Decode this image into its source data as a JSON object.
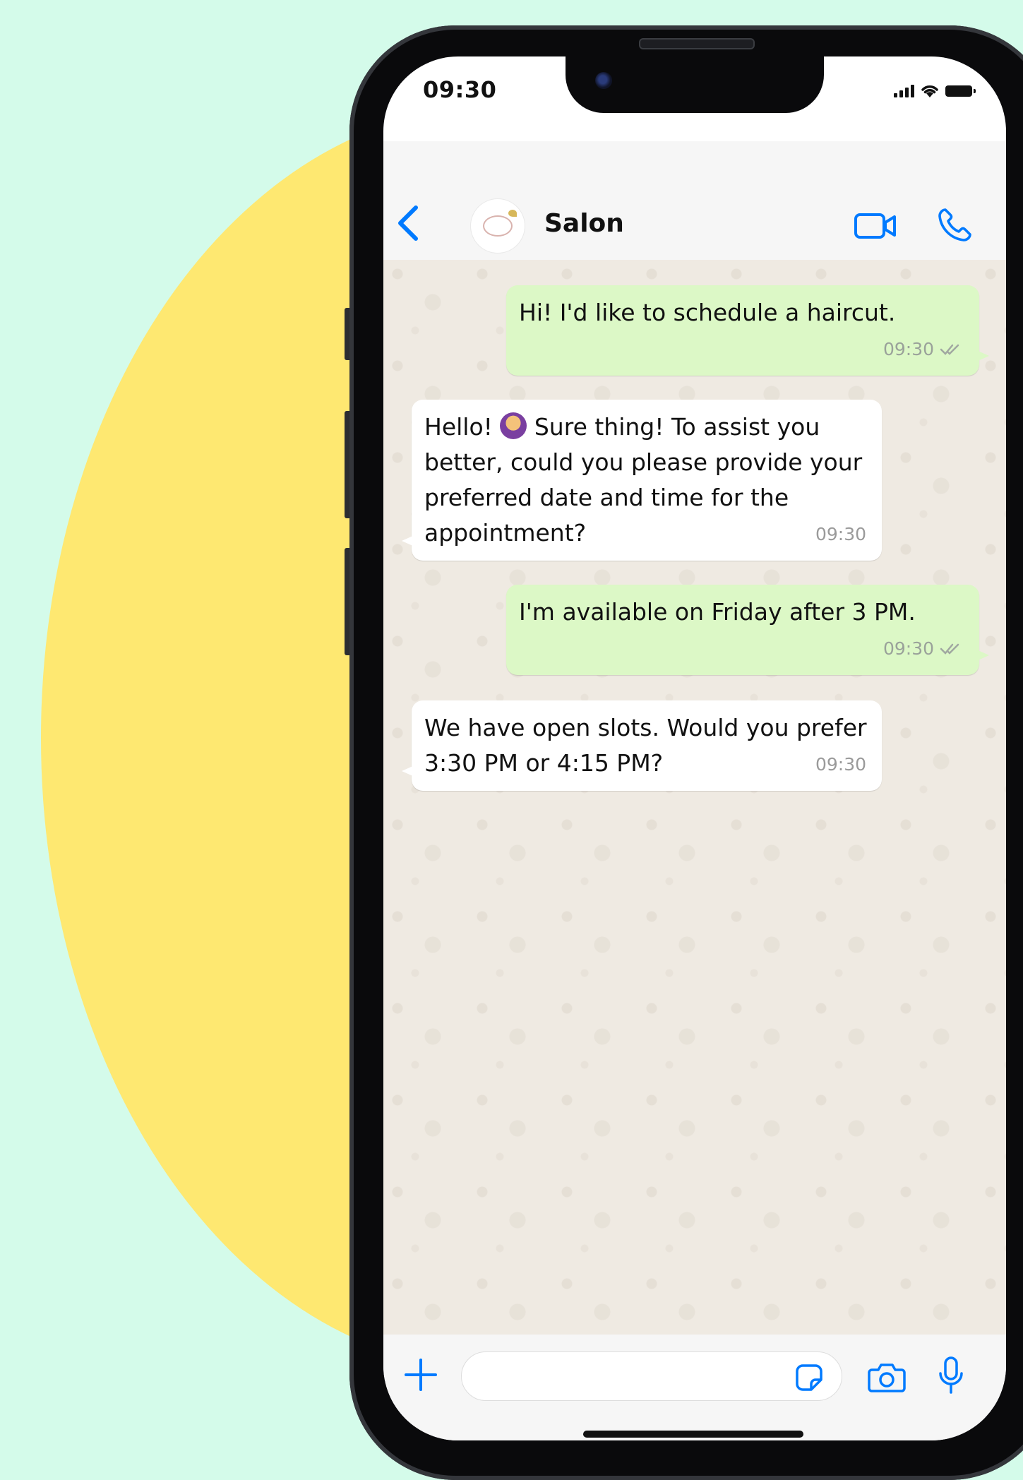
{
  "status_bar": {
    "time": "09:30"
  },
  "header": {
    "contact_name": "Salon"
  },
  "messages": [
    {
      "direction": "out",
      "text": "Hi! I'd like to schedule a haircut.",
      "time": "09:30"
    },
    {
      "direction": "in",
      "text_before_emoji": "Hello! ",
      "emoji": "woman-getting-haircut-emoji",
      "text_after_emoji": " Sure thing! To assist you\nbetter, could you please provide your\npreferred date and time for the\nappointment?",
      "time": "09:30"
    },
    {
      "direction": "out",
      "text": "I'm available on Friday after 3 PM.",
      "time": "09:30"
    },
    {
      "direction": "in",
      "text": "We have open slots. Would you prefer\n3:30 PM or 4:15 PM?",
      "time": "09:30"
    }
  ],
  "composer": {
    "input_value": ""
  },
  "colors": {
    "background": "#d4fbea",
    "blob": "#fee871",
    "outgoing_bubble": "#dcf8c6",
    "incoming_bubble": "#ffffff",
    "accent": "#007aff",
    "chat_wallpaper": "#efeae2"
  },
  "icons": [
    "back-icon",
    "avatar",
    "video-call-icon",
    "voice-call-icon",
    "double-check-icon",
    "plus-icon",
    "sticker-icon",
    "camera-icon",
    "microphone-icon",
    "signal-icon",
    "wifi-icon",
    "battery-icon"
  ]
}
